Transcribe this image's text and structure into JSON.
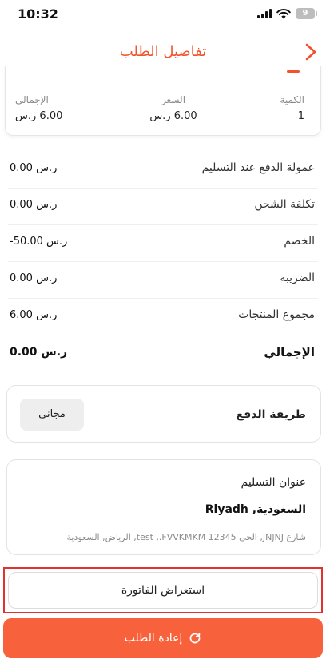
{
  "status_bar": {
    "time": "10:32",
    "battery": "9"
  },
  "header": {
    "title": "تفاصيل الطلب"
  },
  "summary": {
    "quantity_label": "الكمية",
    "quantity_value": "1",
    "price_label": "السعر",
    "price_value": "6.00 ر.س",
    "total_label": "الإجمالي",
    "total_value": "6.00 ر.س"
  },
  "price_rows": [
    {
      "label": "عمولة الدفع عند التسليم",
      "value": "0.00 ر.س"
    },
    {
      "label": "تكلفة الشحن",
      "value": "0.00 ر.س"
    },
    {
      "label": "الخصم",
      "value": "-50.00 ر.س"
    },
    {
      "label": "الضريبة",
      "value": "0.00 ر.س"
    },
    {
      "label": "مجموع المنتجات",
      "value": "6.00 ر.س"
    },
    {
      "label": "الإجمالي",
      "value": "0.00 ر.س"
    }
  ],
  "payment": {
    "label": "طريقة الدفع",
    "value": "مجاني"
  },
  "address": {
    "title": "عنوان التسليم",
    "city": "السعودية, Riyadh",
    "line": "شارع JNJNJ, الحي test ,.FVVKMKM 12345, الرياض, السعودية"
  },
  "buttons": {
    "invoice": "استعراض الفاتورة",
    "reorder": "إعادة الطلب"
  },
  "colors": {
    "accent": "#f0542d",
    "button": "#f7623c",
    "highlight": "#e23131"
  }
}
